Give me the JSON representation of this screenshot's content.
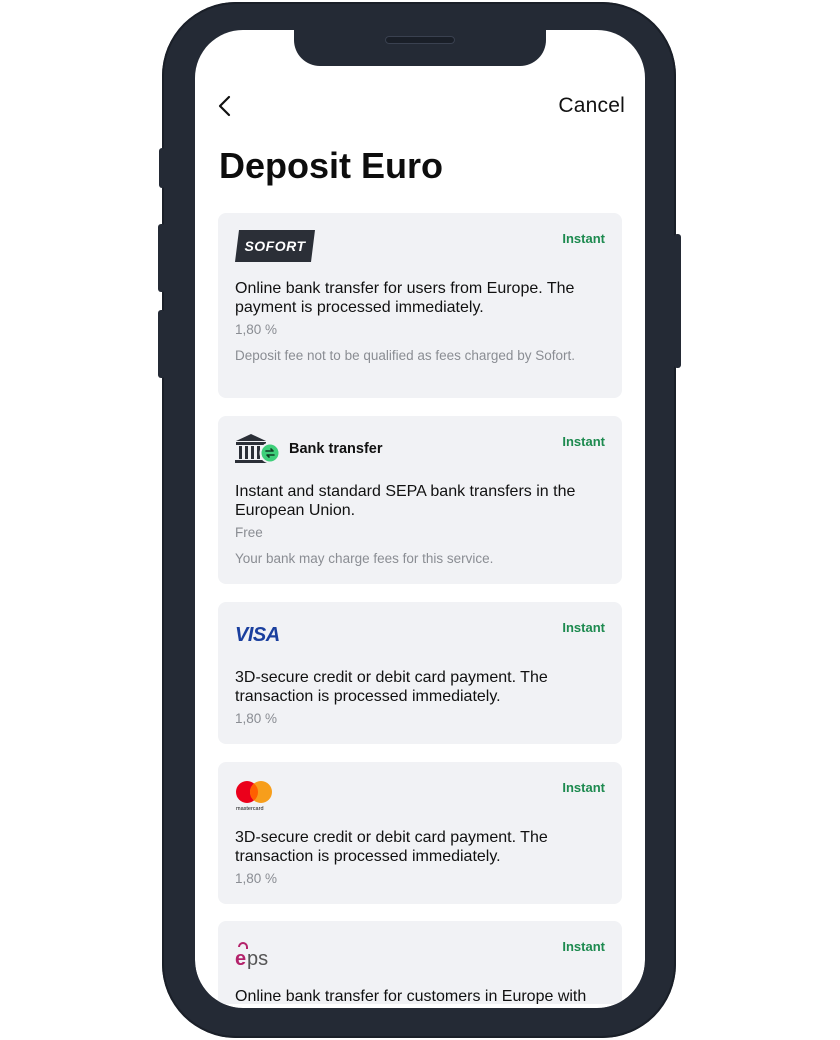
{
  "nav": {
    "cancel_label": "Cancel",
    "back_icon": "chevron-left-icon"
  },
  "page": {
    "title": "Deposit Euro"
  },
  "colors": {
    "instant": "#1d8a4f",
    "card_bg": "#f1f2f5",
    "frame": "#242a35",
    "visa": "#1a3f9e"
  },
  "methods": [
    {
      "logo": "sofort-logo",
      "logo_text": "SOFORT",
      "badge": "Instant",
      "description": "Online bank transfer for users from Europe. The payment is processed immediately.",
      "fee": "1,80 %",
      "note": "Deposit fee not to be qualified as fees charged by Sofort."
    },
    {
      "logo": "bank-icon",
      "logo_label": "Bank transfer",
      "badge": "Instant",
      "description": "Instant and standard SEPA bank transfers in the European Union.",
      "fee": "Free",
      "note": "Your bank may charge fees for this service."
    },
    {
      "logo": "visa-logo",
      "logo_text": "VISA",
      "badge": "Instant",
      "description": "3D-secure credit or debit card payment. The transaction is processed immediately.",
      "fee": "1,80 %"
    },
    {
      "logo": "mastercard-logo",
      "logo_text": "mastercard",
      "badge": "Instant",
      "description": "3D-secure credit or debit card payment. The transaction is processed immediately.",
      "fee": "1,80 %"
    },
    {
      "logo": "eps-logo",
      "logo_text": "eps",
      "badge": "Instant",
      "description": "Online bank transfer for customers in Europe with"
    }
  ]
}
